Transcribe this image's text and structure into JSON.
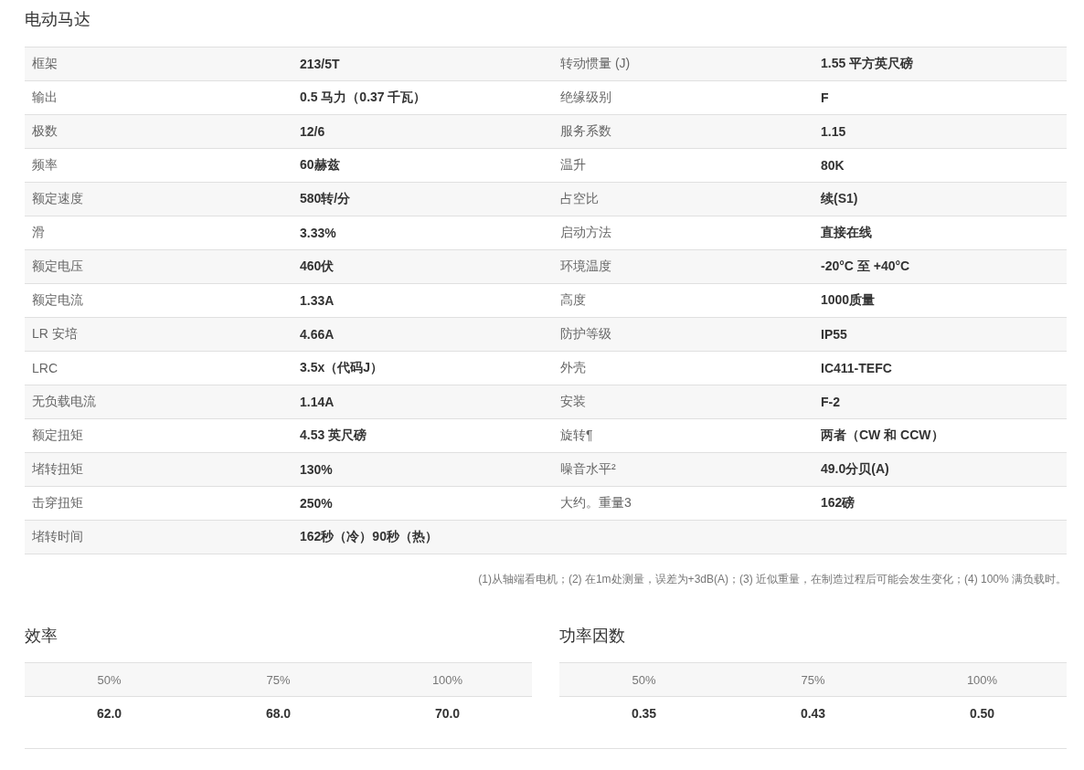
{
  "title": "电动马达",
  "specs": [
    [
      {
        "label": "框架",
        "value": "213/5T"
      },
      {
        "label": "转动惯量 (J)",
        "value": "1.55 平方英尺磅"
      }
    ],
    [
      {
        "label": "输出",
        "value": "0.5 马力（0.37 千瓦）"
      },
      {
        "label": "绝缘级别",
        "value": "F"
      }
    ],
    [
      {
        "label": "极数",
        "value": "12/6"
      },
      {
        "label": "服务系数",
        "value": "1.15"
      }
    ],
    [
      {
        "label": "频率",
        "value": "60赫兹"
      },
      {
        "label": "温升",
        "value": "80K"
      }
    ],
    [
      {
        "label": "额定速度",
        "value": "580转/分"
      },
      {
        "label": "占空比",
        "value": "续(S1)"
      }
    ],
    [
      {
        "label": "滑",
        "value": "3.33%"
      },
      {
        "label": "启动方法",
        "value": "直接在线"
      }
    ],
    [
      {
        "label": "额定电压",
        "value": "460伏"
      },
      {
        "label": "环境温度",
        "value": "-20°C 至 +40°C"
      }
    ],
    [
      {
        "label": "额定电流",
        "value": "1.33A"
      },
      {
        "label": "高度",
        "value": "1000质量"
      }
    ],
    [
      {
        "label": "LR 安培",
        "value": "4.66A"
      },
      {
        "label": "防护等级",
        "value": "IP55"
      }
    ],
    [
      {
        "label": "LRC",
        "value": "3.5x（代码J）"
      },
      {
        "label": "外壳",
        "value": "IC411-TEFC"
      }
    ],
    [
      {
        "label": "无负载电流",
        "value": "1.14A"
      },
      {
        "label": "安装",
        "value": "F-2"
      }
    ],
    [
      {
        "label": "额定扭矩",
        "value": "4.53 英尺磅"
      },
      {
        "label": "旋转¶",
        "value": "两者（CW 和 CCW）"
      }
    ],
    [
      {
        "label": "堵转扭矩",
        "value": "130%"
      },
      {
        "label": "噪音水平²",
        "value": "49.0分贝(A)"
      }
    ],
    [
      {
        "label": "击穿扭矩",
        "value": "250%"
      },
      {
        "label": "大约。重量3",
        "value": "162磅"
      }
    ],
    [
      {
        "label": "堵转时间",
        "value": "162秒（冷）90秒（热）"
      }
    ]
  ],
  "footnote": "(1)从轴端看电机；(2) 在1m处测量，误差为+3dB(A)；(3) 近似重量，在制造过程后可能会发生变化；(4) 100% 满负载时。",
  "load_tables": [
    {
      "title": "效率",
      "columns": [
        "50%",
        "75%",
        "100%"
      ],
      "values": [
        "62.0",
        "68.0",
        "70.0"
      ]
    },
    {
      "title": "功率因数",
      "columns": [
        "50%",
        "75%",
        "100%"
      ],
      "values": [
        "0.35",
        "0.43",
        "0.50"
      ]
    }
  ]
}
